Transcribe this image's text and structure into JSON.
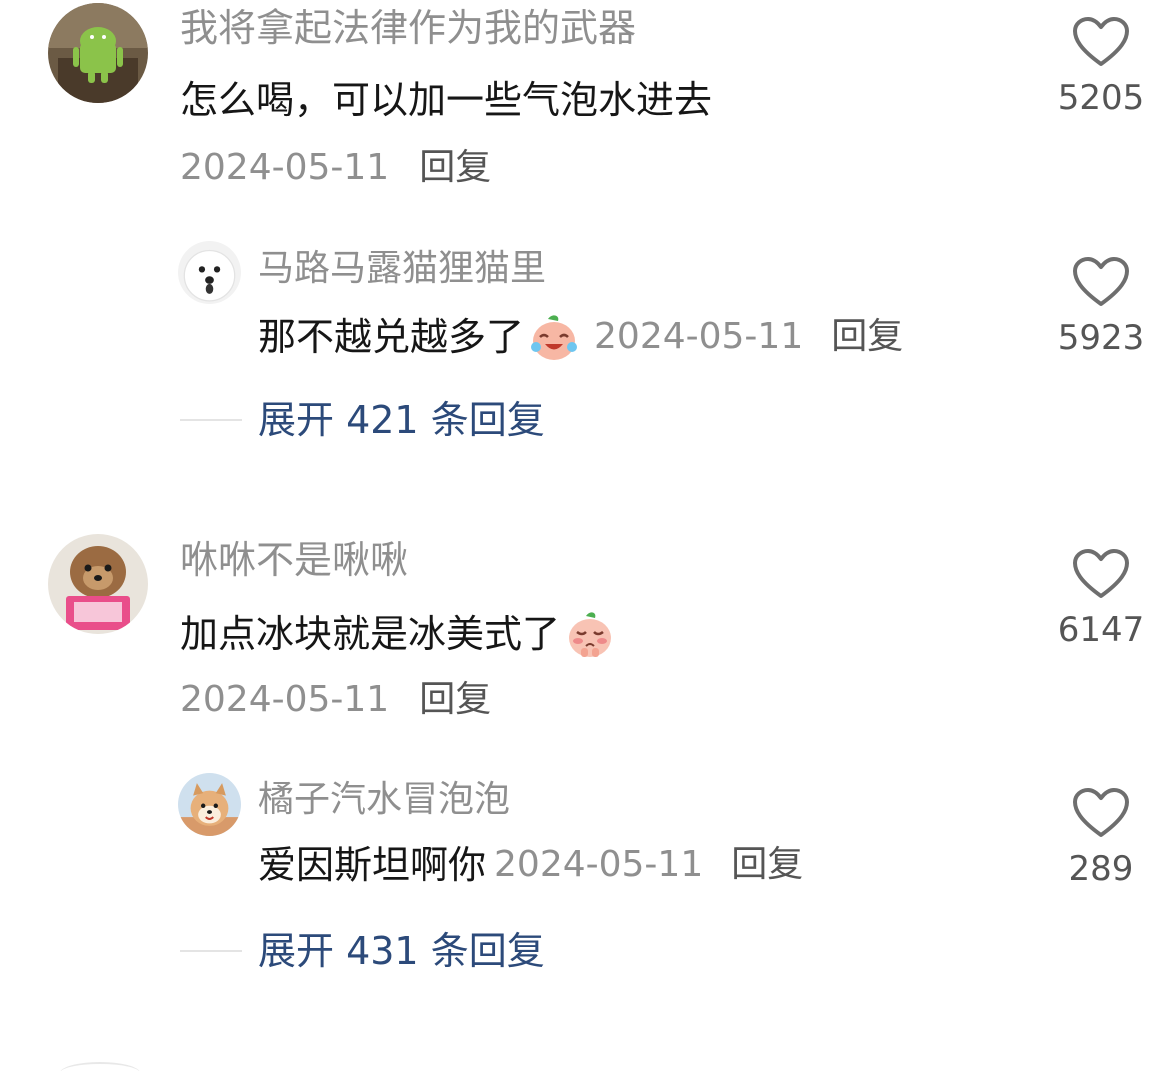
{
  "comments": [
    {
      "username": "我将拿起法律作为我的武器",
      "text": "怎么喝，可以加一些气泡水进去",
      "date": "2024-05-11",
      "reply_label": "回复",
      "likes": "5205",
      "avatar_icon": "android-robot-avatar",
      "reply": {
        "username": "马路马露猫狸猫里",
        "text": "那不越兑越多了",
        "emoji": "crying-laughing-emoji",
        "date": "2024-05-11",
        "reply_label": "回复",
        "likes": "5923",
        "avatar_icon": "white-dog-avatar"
      },
      "expand_label": "展开 421 条回复"
    },
    {
      "username": "咻咻不是啾啾",
      "text": "加点冰块就是冰美式了",
      "emoji": "shy-emoji",
      "date": "2024-05-11",
      "reply_label": "回复",
      "likes": "6147",
      "avatar_icon": "dog-reading-book-avatar",
      "reply": {
        "username": "橘子汽水冒泡泡",
        "text": "爱因斯坦啊你",
        "date": "2024-05-11",
        "reply_label": "回复",
        "likes": "289",
        "avatar_icon": "shiba-dog-avatar"
      },
      "expand_label": "展开 431 条回复"
    }
  ],
  "colors": {
    "username": "#8f8f8f",
    "text": "#161616",
    "expand_link": "#2c4a7a",
    "like_count": "#555555"
  }
}
